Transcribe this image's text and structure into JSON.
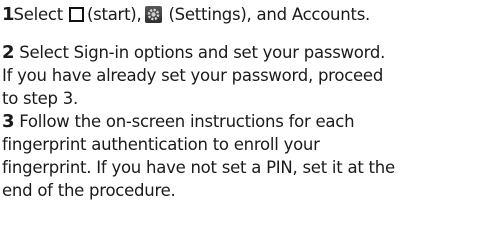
{
  "icons": [
    "start-icon",
    "settings-icon"
  ],
  "colors": {
    "text": "#1a1a1a",
    "background": "#ffffff"
  },
  "step1": {
    "number": "1",
    "part_a": "Select",
    "part_b": "(start),",
    "part_c": " (Settings), and Accounts."
  },
  "step2": {
    "number": "2",
    "line1": " Select Sign-in options and set your password.",
    "line2": "If you have already set your password, proceed",
    "line3": "to step 3."
  },
  "step3": {
    "number": "3",
    "line1": " Follow the on-screen instructions for each",
    "line2": "fingerprint authentication to enroll your",
    "line3": "fingerprint. If you have not set a PIN, set it at the",
    "line4": "end of the procedure."
  }
}
